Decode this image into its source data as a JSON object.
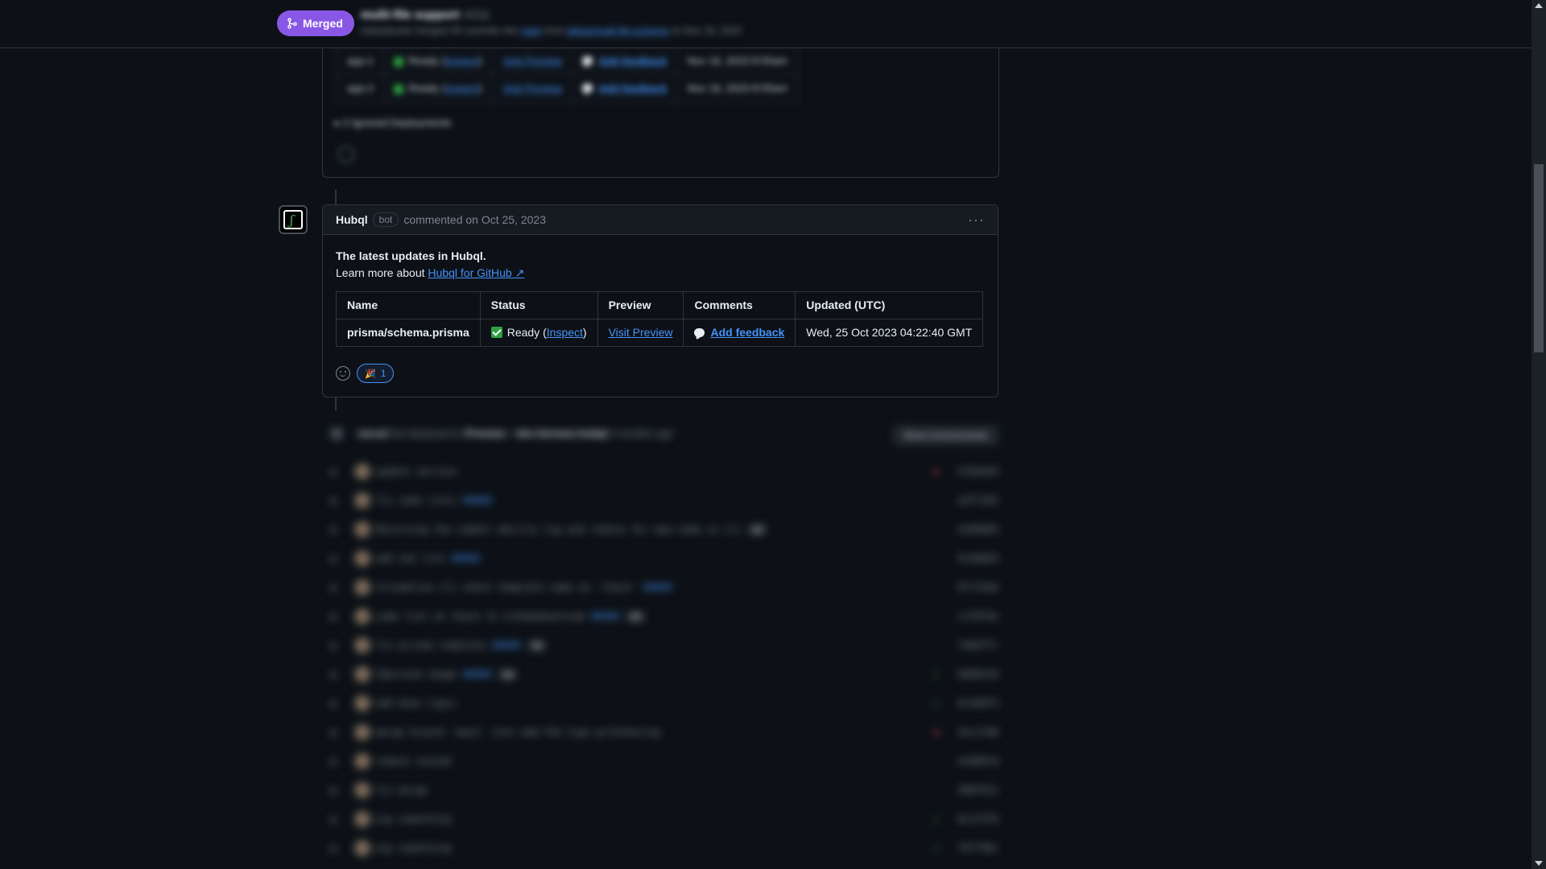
{
  "header": {
    "merged_label": "Merged",
    "pr_title": "multi-file support",
    "pr_number": "#211",
    "subtitle_prefix": "tobiasbuske merged 45 commits into",
    "subtitle_base": "main",
    "subtitle_from": "from",
    "subtitle_head": "tobias/multi-file-schema",
    "subtitle_suffix": "on Nov 16, 2023"
  },
  "previous_comment": {
    "rows": [
      {
        "name": "app-1",
        "status": "Ready",
        "inspect": "Inspect",
        "preview": "Visit Preview",
        "feedback": "Add feedback",
        "updated": "Nov 16, 2023 8:55am"
      },
      {
        "name": "app-2",
        "status": "Ready",
        "inspect": "Inspect",
        "preview": "Visit Preview",
        "feedback": "Add feedback",
        "updated": "Nov 16, 2023 8:55am"
      }
    ],
    "ignored": "2 Ignored Deployments"
  },
  "comment": {
    "author": "Hubql",
    "badge": "bot",
    "commented": "commented on Oct 25, 2023",
    "more": "···",
    "body_title": "The latest updates in Hubql.",
    "learn_prefix": "Learn more about",
    "learn_link": "Hubql for GitHub ↗",
    "table": {
      "headers": [
        "Name",
        "Status",
        "Preview",
        "Comments",
        "Updated (UTC)"
      ],
      "row": {
        "name": "prisma/schema.prisma",
        "status": "Ready (",
        "inspect": "Inspect",
        "status_close": ")",
        "preview": "Visit Preview",
        "feedback": "Add feedback",
        "updated": "Wed, 25 Oct 2023 04:22:40 GMT"
      }
    },
    "reaction": {
      "emoji": "🎉",
      "count": "1"
    }
  },
  "timeline": {
    "deploy": {
      "actor": "vercel",
      "badge": "bot",
      "text": "deployed to",
      "env": "Preview – dev-hermes-hubql",
      "time": "3 months ago",
      "button": "Show environments"
    },
    "commits": [
      {
        "msg": "update version",
        "link": "",
        "count": "",
        "status": "fail",
        "sha": "5f8a9d3"
      },
      {
        "msg": "fix some lints",
        "link": "#####",
        "count": "",
        "status": "",
        "sha": "a3f7292"
      },
      {
        "msg": "Returning the commit ability log and reduce for www same in cli",
        "link": "",
        "count": "42",
        "status": "",
        "sha": "e4d90d5"
      },
      {
        "msg": "add new lint",
        "link": "#####",
        "count": "",
        "status": "",
        "sha": "9c0d603"
      },
      {
        "msg": "streamline cli check template name on 'check'",
        "link": "#####",
        "count": "",
        "status": "",
        "sha": "0717de6"
      },
      {
        "msg": "some lint on check to schemadownload",
        "link": "#####",
        "count": "20",
        "status": "",
        "sha": "c1f0f4e"
      },
      {
        "msg": "fix prisma template",
        "link": "#####",
        "count": "19",
        "status": "",
        "sha": "7d6d7fc"
      },
      {
        "msg": "Improved image",
        "link": "#####",
        "count": "18",
        "status": "ok",
        "sha": "9b8b419"
      },
      {
        "msg": "add base logic",
        "link": "",
        "count": "",
        "status": "ok",
        "sha": "8c4d9f3"
      },
      {
        "msg": "merge branch 'main' into add-fkk-logs-grthsharing",
        "link": "",
        "count": "",
        "status": "fail",
        "sha": "3ec1fd8"
      },
      {
        "msg": "remove unused",
        "link": "",
        "count": "",
        "status": "",
        "sha": "a5d89fd"
      },
      {
        "msg": "fix merge",
        "link": "",
        "count": "",
        "status": "",
        "sha": "380f611"
      },
      {
        "msg": "wip something",
        "link": "",
        "count": "",
        "status": "ok",
        "sha": "8c1f5f6"
      },
      {
        "msg": "wip something",
        "link": "",
        "count": "",
        "status": "ok",
        "sha": "707799c"
      }
    ]
  },
  "colors": {
    "merged": "#8957e5",
    "link": "#4493f8",
    "success": "#2ea043",
    "background": "#0d1117",
    "border": "#30363d"
  },
  "icons": {
    "merge": "git-merge-icon",
    "check": "check-square-icon",
    "chat": "chat-bubble-icon",
    "smiley": "smiley-icon",
    "more": "kebab-horizontal-icon"
  }
}
